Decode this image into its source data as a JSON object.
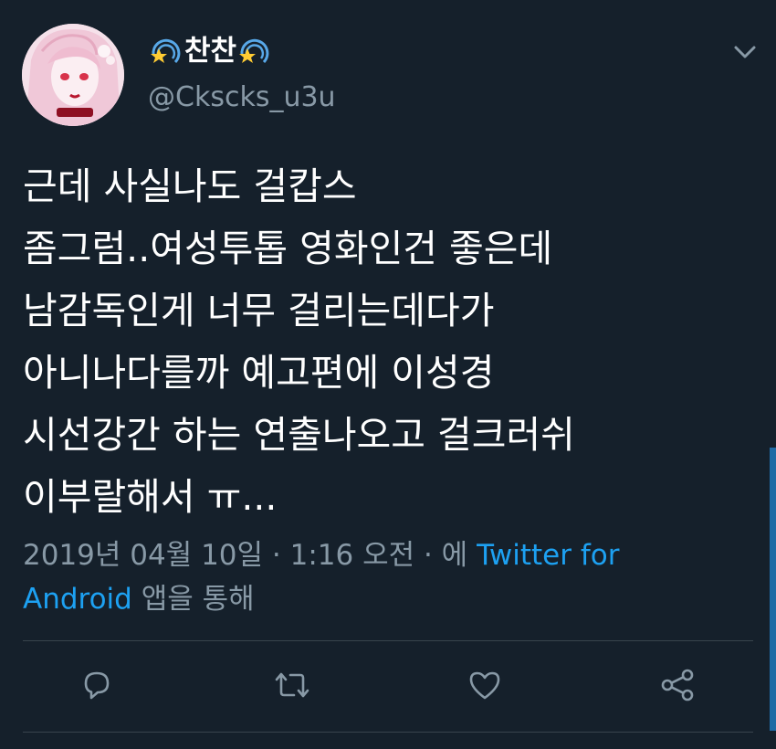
{
  "author": {
    "display_name": "찬찬",
    "handle": "@Ckscks_u3u",
    "name_icon": "dizzy-icon",
    "avatar": "anime-style-avatar"
  },
  "tweet": {
    "lines": [
      "근데 사실나도 걸캅스",
      "좀그럼..여성투톱 영화인건 좋은데",
      "남감독인게 너무 걸리는데다가",
      "아니나다를까 예고편에 이성경",
      "시선강간 하는 연출나오고 걸크러쉬",
      "이부랄해서 ㅠ..."
    ]
  },
  "meta": {
    "timestamp_prefix": "2019년 04월 10일 · 1:16 오전 · 에 ",
    "source_link_part1": "Twitter for",
    "source_link_part2": "Android",
    "suffix": " 앱을 통해"
  },
  "actions": [
    {
      "name": "reply",
      "icon": "reply-icon"
    },
    {
      "name": "retweet",
      "icon": "retweet-icon"
    },
    {
      "name": "like",
      "icon": "heart-icon"
    },
    {
      "name": "share",
      "icon": "share-icon"
    }
  ],
  "colors": {
    "background": "#15202b",
    "text": "#ffffff",
    "secondary_text": "#8899a6",
    "link": "#1da1f2",
    "divider": "#38444d"
  }
}
